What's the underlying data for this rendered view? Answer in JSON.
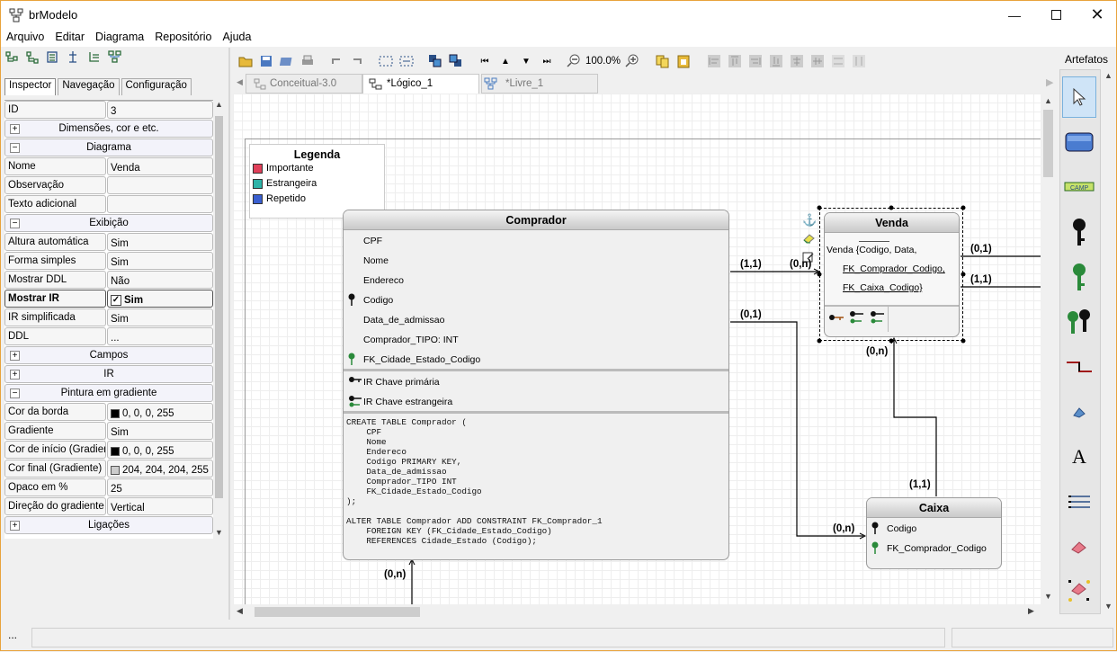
{
  "window": {
    "title": "brModelo",
    "min_icon": "minimize-icon",
    "max_icon": "maximize-icon",
    "close_icon": "close-icon"
  },
  "menu": [
    "Arquivo",
    "Editar",
    "Diagrama",
    "Repositório",
    "Ajuda"
  ],
  "inspector": {
    "tabs": [
      "Inspector",
      "Navegação",
      "Configuração"
    ],
    "rows": [
      {
        "type": "prop",
        "key": "ID",
        "value": "3"
      },
      {
        "type": "group",
        "sign": "+",
        "label": "Dimensões, cor e etc."
      },
      {
        "type": "group",
        "sign": "−",
        "label": "Diagrama"
      },
      {
        "type": "prop",
        "key": "Nome",
        "value": "Venda"
      },
      {
        "type": "prop",
        "key": "Observação",
        "value": ""
      },
      {
        "type": "prop",
        "key": "Texto adicional",
        "value": ""
      },
      {
        "type": "group",
        "sign": "−",
        "label": "Exibição"
      },
      {
        "type": "prop",
        "key": "Altura automática",
        "value": "Sim"
      },
      {
        "type": "prop",
        "key": "Forma simples",
        "value": "Sim"
      },
      {
        "type": "prop",
        "key": "Mostrar DDL",
        "value": "Não"
      },
      {
        "type": "prop",
        "key": "Mostrar IR",
        "value": "Sim",
        "checkbox": true,
        "bold": true
      },
      {
        "type": "prop",
        "key": "IR simplificada",
        "value": "Sim"
      },
      {
        "type": "prop",
        "key": "DDL",
        "value": "..."
      },
      {
        "type": "group",
        "sign": "+",
        "label": "Campos"
      },
      {
        "type": "group",
        "sign": "+",
        "label": "IR"
      },
      {
        "type": "group",
        "sign": "−",
        "label": "Pintura em gradiente"
      },
      {
        "type": "prop",
        "key": "Cor da borda",
        "value": "0, 0, 0, 255",
        "swatch": "#000000"
      },
      {
        "type": "prop",
        "key": "Gradiente",
        "value": "Sim"
      },
      {
        "type": "prop",
        "key": "Cor de início (Gradiente)",
        "value": "0, 0, 0, 255",
        "swatch": "#000000"
      },
      {
        "type": "prop",
        "key": "Cor final (Gradiente)",
        "value": "204, 204, 204, 255",
        "swatch": "#cccccc"
      },
      {
        "type": "prop",
        "key": "Opaco em %",
        "value": "25"
      },
      {
        "type": "prop",
        "key": "Direção do gradiente",
        "value": "Vertical"
      },
      {
        "type": "group",
        "sign": "+",
        "label": "Ligações"
      }
    ]
  },
  "toolbar": {
    "zoom": "100.0%"
  },
  "doc_tabs": [
    "Conceitual-3.0",
    "*Lógico_1",
    "*Livre_1"
  ],
  "legend": {
    "title": "Legenda",
    "items": [
      {
        "label": "Importante",
        "color": "#e0405a"
      },
      {
        "label": "Estrangeira",
        "color": "#2db3a8"
      },
      {
        "label": "Repetido",
        "color": "#3a5fd0"
      }
    ]
  },
  "comprador": {
    "title": "Comprador",
    "attrs": [
      "CPF",
      "Nome",
      "Endereco",
      "Codigo",
      "Data_de_admissao",
      "Comprador_TIPO: INT",
      "FK_Cidade_Estado_Codigo"
    ],
    "ir": [
      "IR Chave primária",
      "IR Chave estrangeira"
    ],
    "ddl": "CREATE TABLE Comprador (\n    CPF\n    Nome\n    Endereco\n    Codigo PRIMARY KEY,\n    Data_de_admissao\n    Comprador_TIPO INT\n    FK_Cidade_Estado_Codigo\n);\n\nALTER TABLE Comprador ADD CONSTRAINT FK_Comprador_1\n    FOREIGN KEY (FK_Cidade_Estado_Codigo)\n    REFERENCES Cidade_Estado (Codigo);"
  },
  "venda": {
    "title": "Venda",
    "line1": "Venda {Codigo, Data,",
    "line2": "FK_Comprador_Codigo,",
    "line3": "FK_Caixa_Codigo}"
  },
  "caixa": {
    "title": "Caixa",
    "attrs": [
      "Codigo",
      "FK_Comprador_Codigo"
    ]
  },
  "cardinalities": [
    "(1,1)",
    "(0,n)",
    "(0,1)",
    "(1,1)",
    "(0,1)",
    "(0,n)",
    "(1,1)",
    "(0,n)",
    "(0,n)"
  ],
  "artefatos": {
    "title": "Artefatos",
    "tools": [
      "pointer-tool",
      "table-tool",
      "field-tool",
      "primary-key-tool",
      "foreign-key-tool",
      "composite-key-tool",
      "relation-tool",
      "paint-tool",
      "text-tool",
      "list-tool",
      "eraser-tool",
      "eraser-points-tool"
    ]
  },
  "status": {
    "text": "..."
  }
}
